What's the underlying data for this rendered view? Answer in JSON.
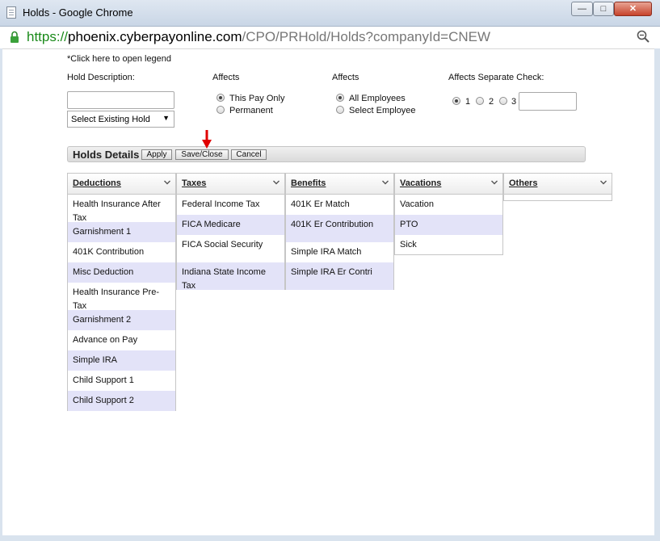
{
  "window": {
    "title": "Holds - Google Chrome"
  },
  "address": {
    "scheme": "https://",
    "host": "phoenix.cyberpayonline.com",
    "path": "/CPO/PRHold/Holds?companyId=CNEW"
  },
  "form": {
    "legend_link": "*Click here to open legend",
    "hold_description_label": "Hold Description:",
    "hold_description_value": "",
    "existing_hold_select": "Select Existing Hold",
    "affects_pay_label": "Affects",
    "affects_pay_options": [
      "This Pay Only",
      "Permanent"
    ],
    "affects_pay_selected": "This Pay Only",
    "affects_emp_label": "Affects",
    "affects_emp_options": [
      "All Employees",
      "Select Employee"
    ],
    "affects_emp_selected": "All Employees",
    "separate_check_label": "Affects Separate Check:",
    "separate_check_options": [
      "1",
      "2",
      "3"
    ],
    "separate_check_selected": "1",
    "separate_check_value": ""
  },
  "details": {
    "title": "Holds Details",
    "apply": "Apply",
    "save_close": "Save/Close",
    "cancel": "Cancel"
  },
  "columns": [
    {
      "title": "Deductions",
      "items": [
        "Health Insurance After Tax",
        "Garnishment 1",
        "401K Contribution",
        "Misc Deduction",
        "Health Insurance Pre-Tax",
        "Garnishment 2",
        "Advance on Pay",
        "Simple IRA",
        "Child Support 1",
        "Child Support 2"
      ]
    },
    {
      "title": "Taxes",
      "items": [
        "Federal Income Tax",
        "FICA Medicare",
        "FICA Social Security",
        "Indiana State Income Tax"
      ]
    },
    {
      "title": "Benefits",
      "items": [
        "401K Er Match",
        "401K Er Contribution",
        "Simple IRA Match",
        "Simple IRA Er Contri"
      ]
    },
    {
      "title": "Vacations",
      "items": [
        "Vacation",
        "PTO",
        "Sick"
      ]
    },
    {
      "title": "Others",
      "items": []
    }
  ],
  "colors": {
    "alt_row": "#e3e3f8",
    "url_scheme": "#1a8a1a",
    "arrow": "#e00000"
  }
}
